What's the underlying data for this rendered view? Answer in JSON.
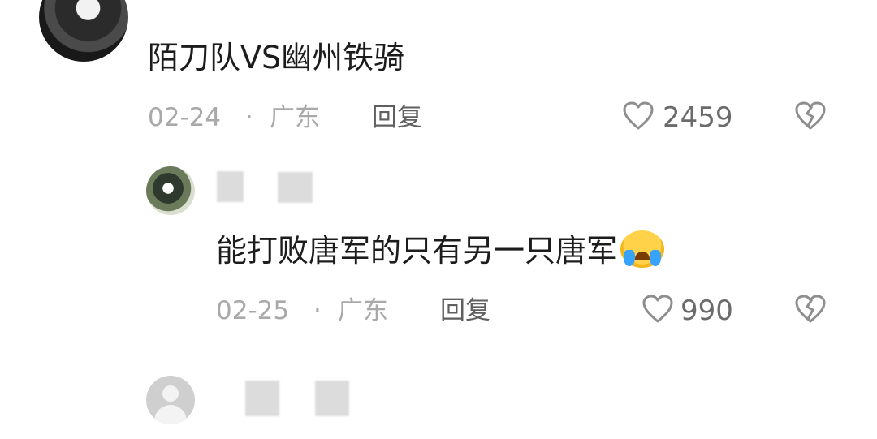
{
  "comment_main": {
    "text": "陌刀队VS幽州铁骑",
    "date": "02-24",
    "sep": "·",
    "location": "广东",
    "reply_label": "回复",
    "likes": "2459"
  },
  "comment_reply": {
    "text": "能打败唐军的只有另一只唐军",
    "date": "02-25",
    "sep": "·",
    "location": "广东",
    "reply_label": "回复",
    "likes": "990",
    "emoji": "loudly-crying-face"
  },
  "colors": {
    "meta": "#a9a9a9",
    "reply": "#5f5f5f",
    "likes": "#6b6b6b",
    "icon": "#8e8e8e"
  },
  "icons": [
    "avatar",
    "heart-icon",
    "dislike-heart-icon",
    "default-avatar-icon"
  ]
}
